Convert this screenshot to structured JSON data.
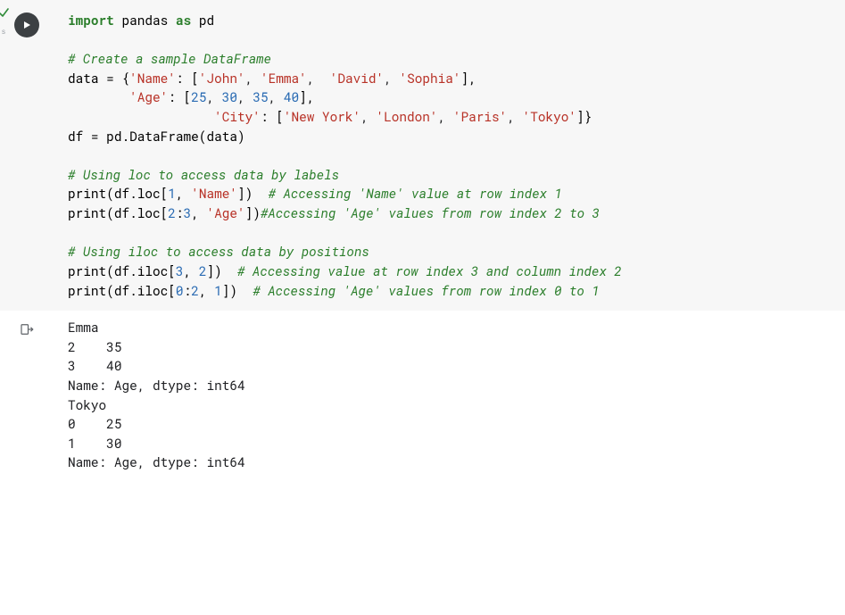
{
  "cell": {
    "code": {
      "l1": {
        "kw1": "import",
        "nm1": "pandas",
        "kw2": "as",
        "nm2": "pd"
      },
      "l3_cm": "# Create a sample DataFrame",
      "l4": {
        "pre": "data = {",
        "k1": "'Name'",
        "sep": ": [",
        "v1": "'John'",
        "v2": "'Emma'",
        "v3": "'David'",
        "v4": "'Sophia'",
        "end": "],"
      },
      "l5": {
        "sp": "        ",
        "k": "'Age'",
        "sep": ": [",
        "n1": "25",
        "n2": "30",
        "n3": "35",
        "n4": "40",
        "end": "],"
      },
      "l6": {
        "sp": "                   ",
        "k": "'City'",
        "sep": ": [",
        "v1": "'New York'",
        "v2": "'London'",
        "v3": "'Paris'",
        "v4": "'Tokyo'",
        "end": "]}"
      },
      "l7": "df = pd.DataFrame(data)",
      "l9_cm": "# Using loc to access data by labels",
      "l10": {
        "pre": "print",
        "open": "(df.loc[",
        "n": "1",
        "c": ", ",
        "s": "'Name'",
        "close": "])  ",
        "cm": "# Accessing 'Name' value at row index 1"
      },
      "l11": {
        "pre": "print",
        "open": "(df.loc[",
        "n1": "2",
        "colon": ":",
        "n2": "3",
        "c": ", ",
        "s": "'Age'",
        "close": "])",
        "cm": "#Accessing 'Age' values from row index 2 to 3"
      },
      "l13_cm": "# Using iloc to access data by positions",
      "l14": {
        "pre": "print",
        "open": "(df.iloc[",
        "n1": "3",
        "c": ", ",
        "n2": "2",
        "close": "])  ",
        "cm": "# Accessing value at row index 3 and column index 2"
      },
      "l15": {
        "pre": "print",
        "open": "(df.iloc[",
        "n1": "0",
        "colon": ":",
        "n2": "2",
        "c": ", ",
        "n3": "1",
        "close": "])  ",
        "cm": "# Accessing 'Age' values from row index 0 to 1"
      }
    },
    "output": {
      "l1": "Emma",
      "l2": "2    35",
      "l3": "3    40",
      "l4": "Name: Age, dtype: int64",
      "l5": "Tokyo",
      "l6": "0    25",
      "l7": "1    30",
      "l8": "Name: Age, dtype: int64"
    }
  }
}
